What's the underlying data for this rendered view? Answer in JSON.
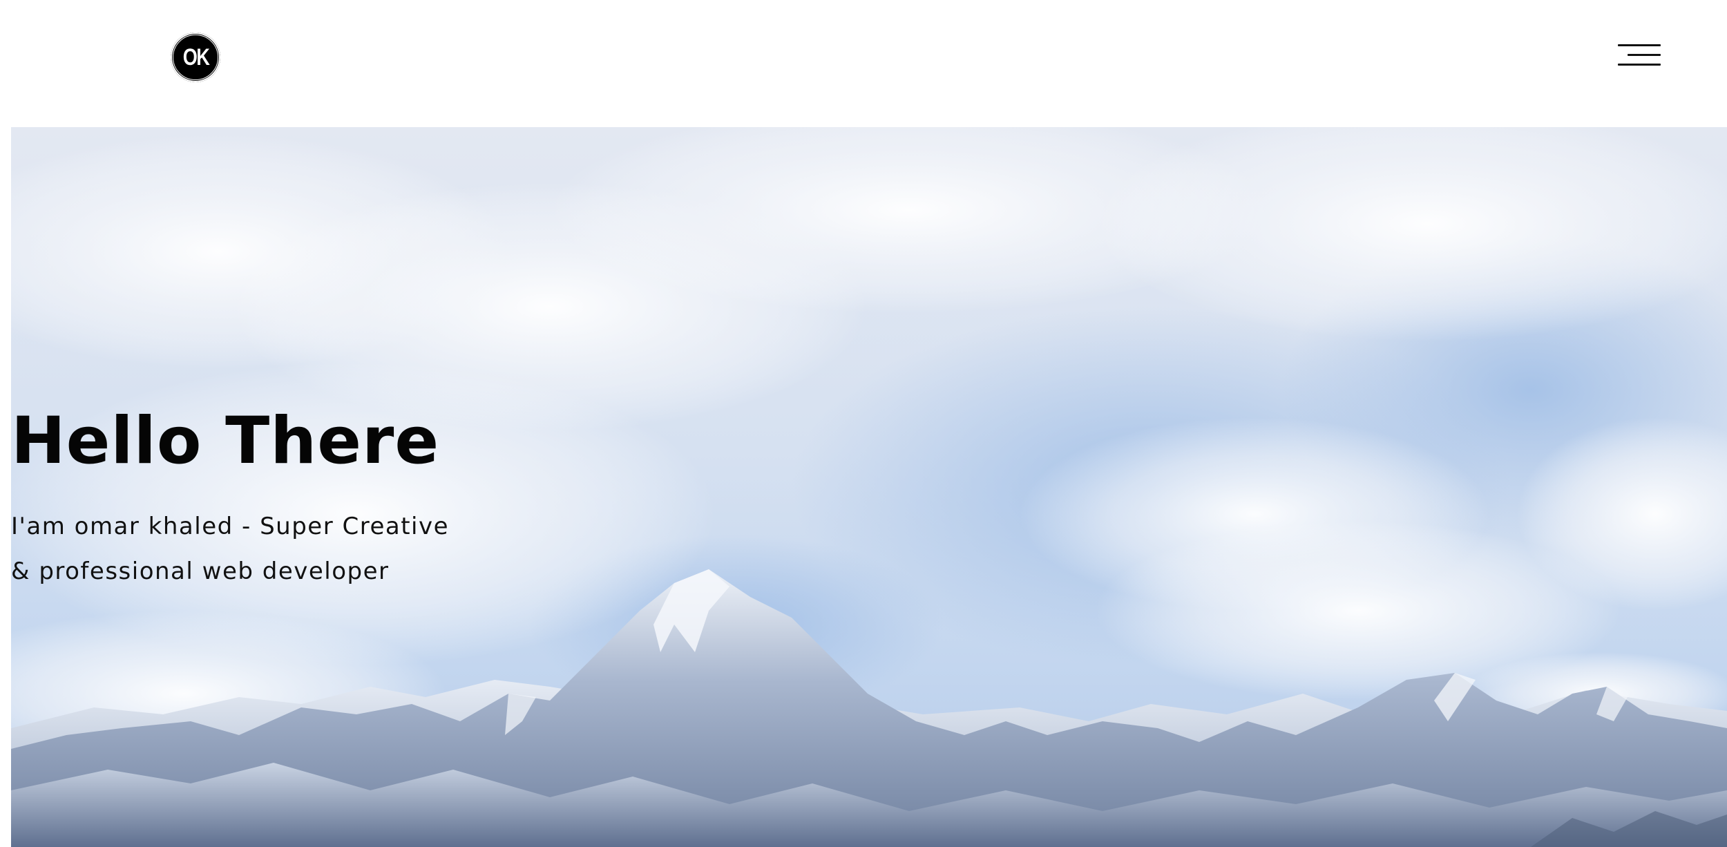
{
  "navbar": {
    "logo_text": "OK",
    "menu_icon": "hamburger-menu-icon"
  },
  "hero": {
    "background": "snowy-mountain-range-under-cloudy-sky",
    "title": "Hello There",
    "subtitle_line1": "I'am omar khaled - Super Creative",
    "subtitle_line2": "& professional web developer"
  },
  "colors": {
    "text": "#000000",
    "logo_bg": "#000000",
    "logo_fg": "#ffffff",
    "sky": "#dce5f3"
  }
}
